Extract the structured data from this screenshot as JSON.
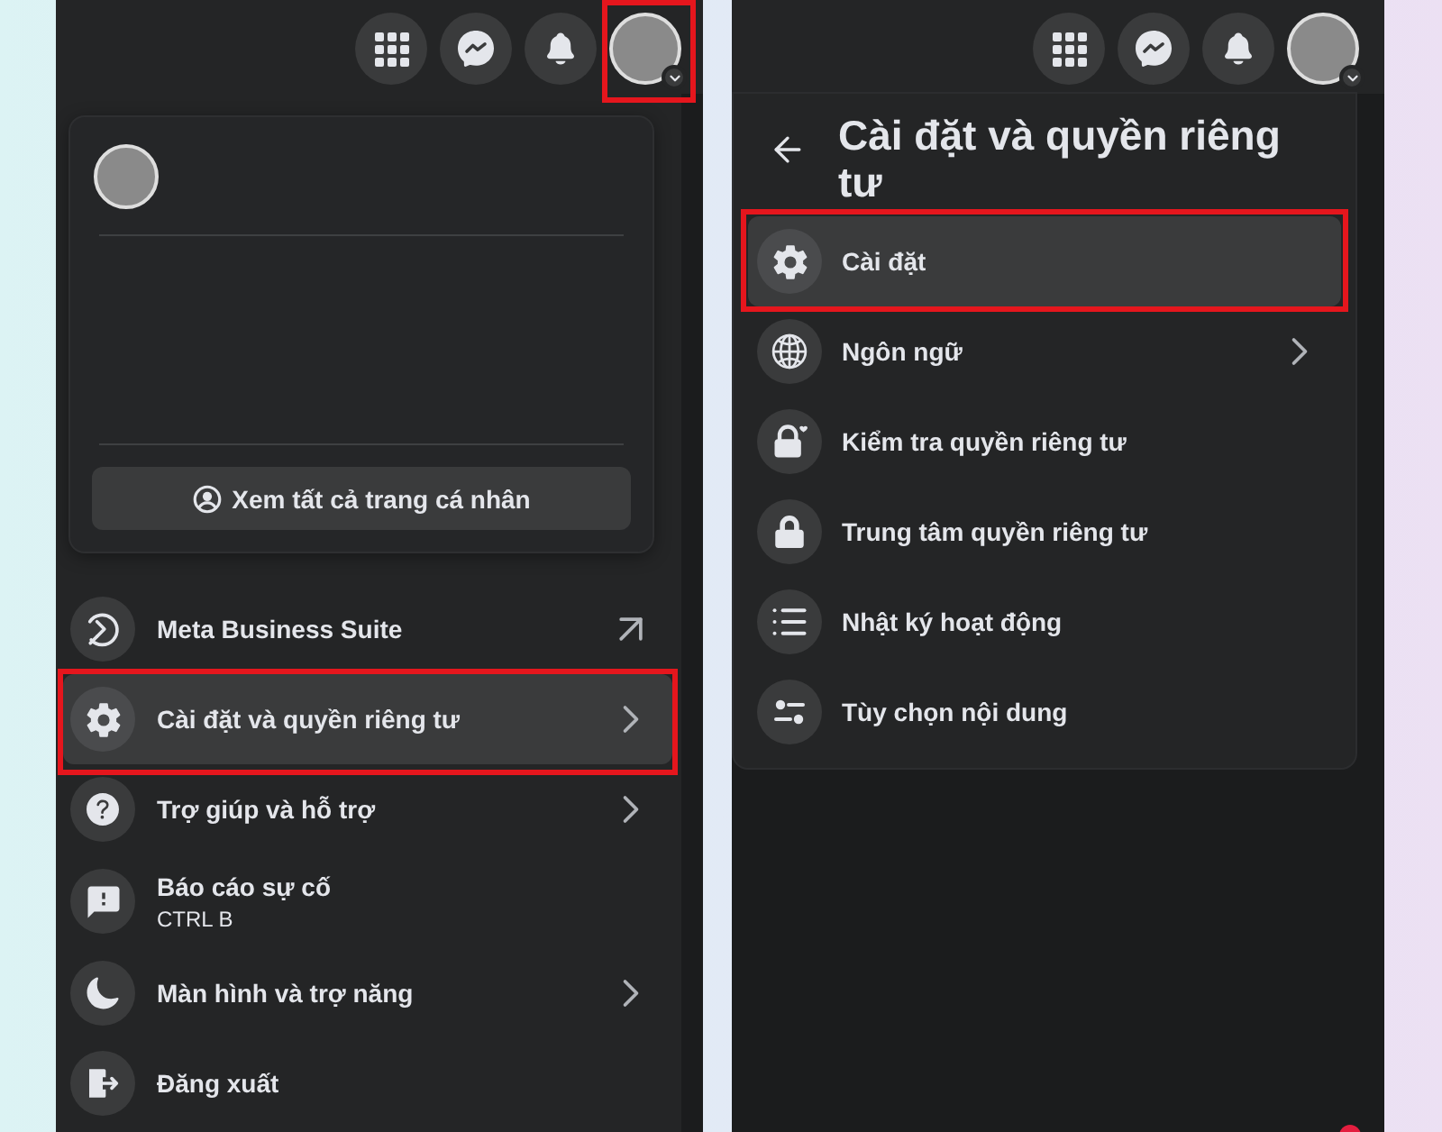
{
  "left_panel": {
    "top_bar": {
      "buttons": [
        {
          "kind": "apps",
          "framed": false
        },
        {
          "kind": "chat",
          "framed": false
        },
        {
          "kind": "notifications",
          "framed": false
        },
        {
          "kind": "account",
          "framed": true
        }
      ]
    },
    "profile_card": {
      "button": "Xem tất cả trang cá nhân"
    },
    "menu_items": [
      {
        "kind": "business",
        "label": "Meta Business Suite",
        "external": true,
        "submenu": false,
        "highlighted": false,
        "framed": false
      },
      {
        "kind": "settings",
        "label": "Cài đặt và quyền riêng tư",
        "external": false,
        "submenu": true,
        "highlighted": true,
        "framed": true
      },
      {
        "kind": "help",
        "label": "Trợ giúp và hỗ trợ",
        "external": false,
        "submenu": true,
        "highlighted": false,
        "framed": false
      },
      {
        "kind": "report",
        "label": "Báo cáo sự cố",
        "shortcut": "CTRL B",
        "external": false,
        "submenu": false,
        "highlighted": false,
        "framed": false
      },
      {
        "kind": "display",
        "label": "Màn hình và trợ năng",
        "external": false,
        "submenu": true,
        "highlighted": false,
        "framed": false
      },
      {
        "kind": "logout",
        "label": "Đăng xuất",
        "external": false,
        "submenu": false,
        "highlighted": false,
        "framed": false
      }
    ]
  },
  "right_panel": {
    "top_bar": {
      "buttons": [
        {
          "kind": "apps",
          "framed": false
        },
        {
          "kind": "chat",
          "framed": false
        },
        {
          "kind": "notifications",
          "framed": false
        },
        {
          "kind": "account",
          "framed": false
        }
      ]
    },
    "header": {
      "title": "Cài đặt và quyền riêng tư"
    },
    "menu_items": [
      {
        "kind": "settings",
        "label": "Cài đặt",
        "submenu": false,
        "highlighted": true,
        "framed": true
      },
      {
        "kind": "language",
        "label": "Ngôn ngữ",
        "submenu": true,
        "highlighted": false,
        "framed": false
      },
      {
        "kind": "checkup",
        "label": "Kiểm tra quyền riêng tư",
        "submenu": false,
        "highlighted": false,
        "framed": false
      },
      {
        "kind": "privacy",
        "label": "Trung tâm quyền riêng tư",
        "submenu": false,
        "highlighted": false,
        "framed": false
      },
      {
        "kind": "activity",
        "label": "Nhật ký hoạt động",
        "submenu": false,
        "highlighted": false,
        "framed": false
      },
      {
        "kind": "preferences",
        "label": "Tùy chọn nội dung",
        "submenu": false,
        "highlighted": false,
        "framed": false
      }
    ]
  }
}
